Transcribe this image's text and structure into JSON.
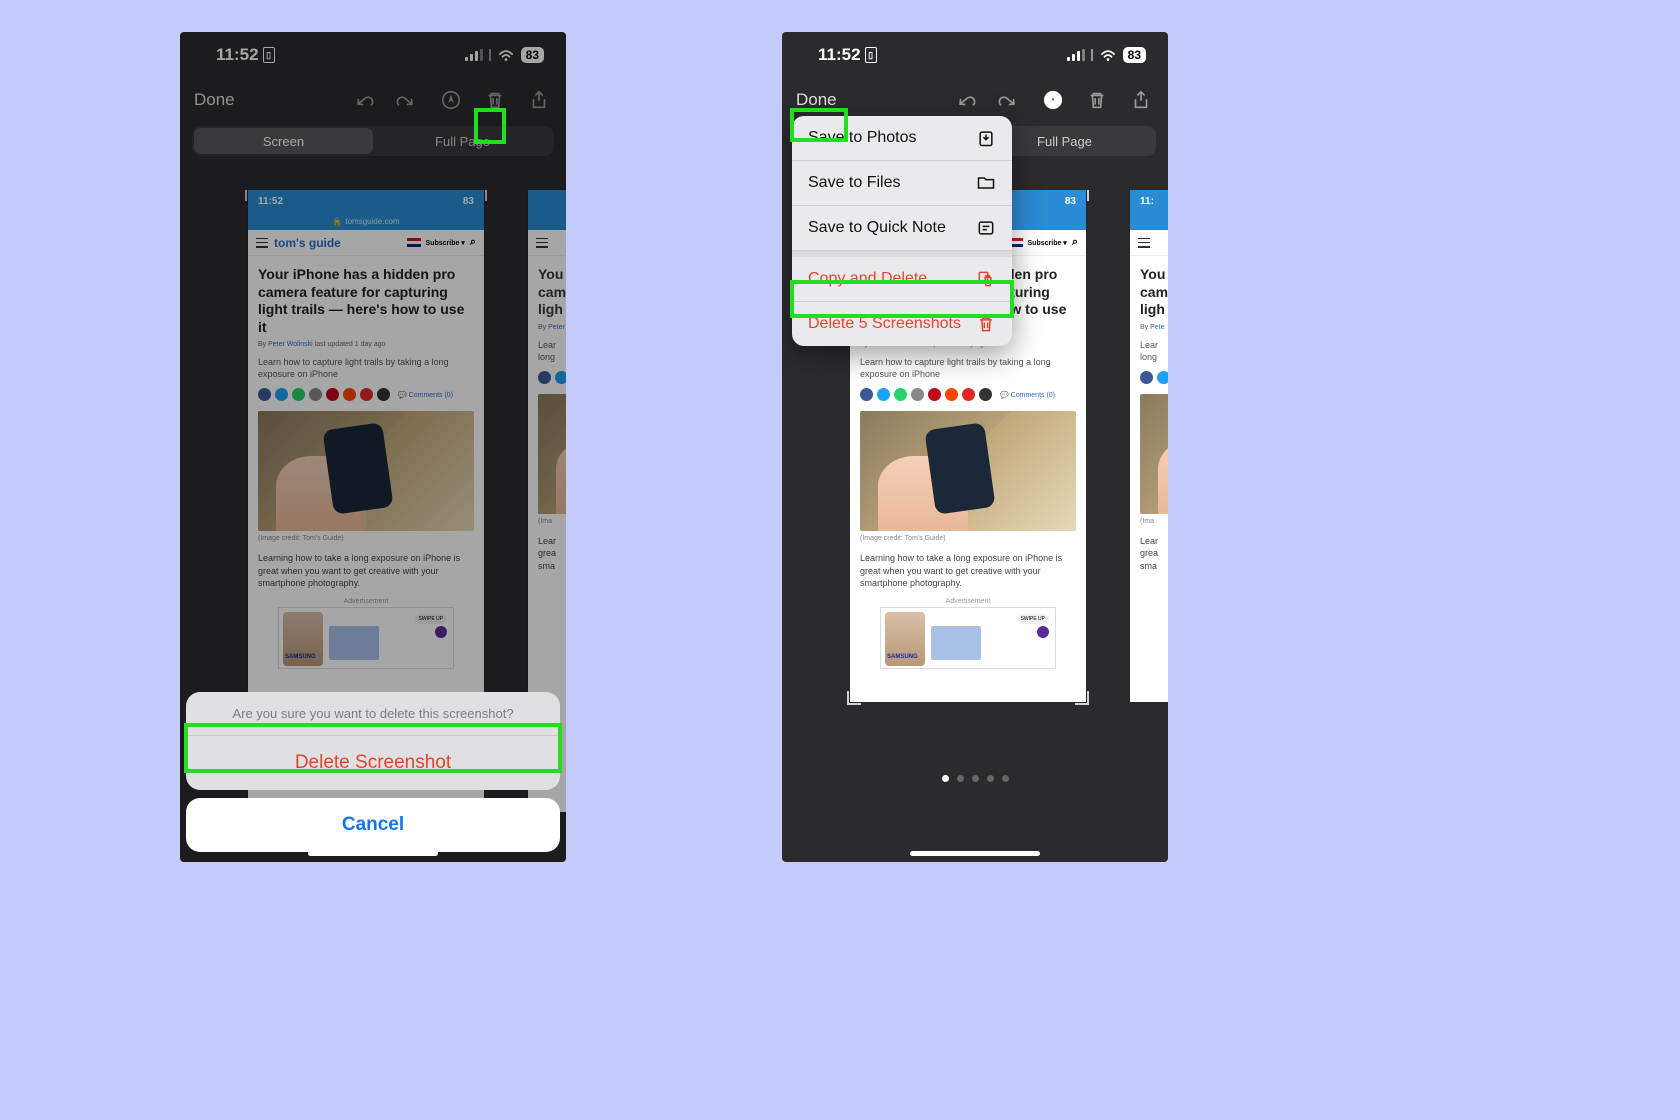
{
  "status": {
    "time": "11:52",
    "battery": "83"
  },
  "toolbar": {
    "done": "Done"
  },
  "segments": {
    "screen": "Screen",
    "fullpage": "Full Page"
  },
  "article": {
    "inner_time": "11:52",
    "inner_battery": "83",
    "url": "tomsguide.com",
    "logo": "tom's guide",
    "subscribe": "Subscribe ▾",
    "headline": "Your iPhone has a hidden pro camera feature for capturing light trails — here's how to use it",
    "byline_prefix": "By ",
    "author": "Peter Wolinski",
    "byline_suffix": " last updated 1 day ago",
    "lede": "Learn how to capture light trails by taking a long exposure on iPhone",
    "comments": "Comments (0)",
    "credit": "(Image credit: Tom's Guide)",
    "body": "Learning how to take a long exposure on iPhone is great when you want to get creative with your smartphone photography.",
    "ad_label": "Advertisement",
    "ad_brand": "SAMSUNG",
    "ad_swipe": "SWIPE UP"
  },
  "sheet": {
    "message": "Are you sure you want to delete this screenshot?",
    "delete": "Delete Screenshot",
    "cancel": "Cancel"
  },
  "menu": {
    "save_photos": "Save to Photos",
    "save_files": "Save to Files",
    "save_note": "Save to Quick Note",
    "copy_delete": "Copy and Delete",
    "delete_n": "Delete 5 Screenshots"
  }
}
